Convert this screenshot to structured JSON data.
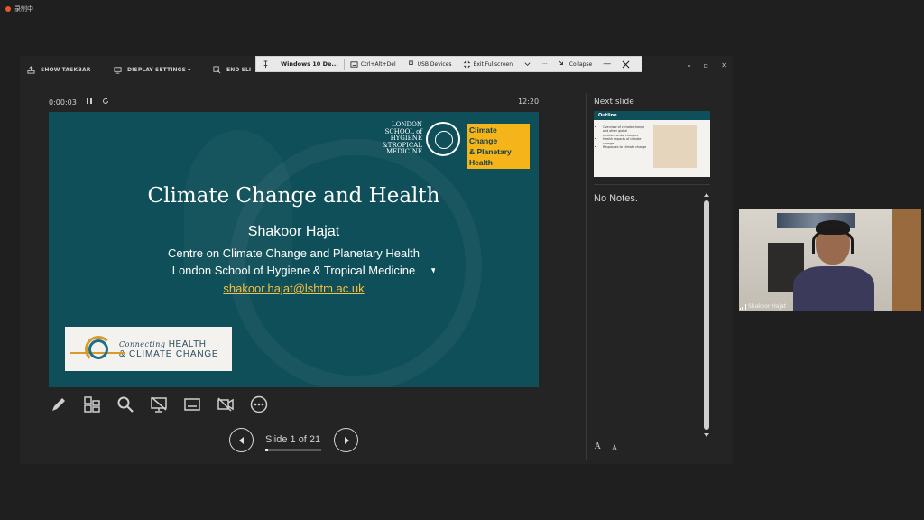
{
  "recorder": {
    "label": "录制中"
  },
  "toolbar": {
    "show_taskbar": "SHOW TASKBAR",
    "display_settings": "DISPLAY SETTINGS ▾",
    "end_slideshow": "END SLI"
  },
  "window_controls": {
    "minimize": "–",
    "restore": "▫",
    "close": "✕"
  },
  "remote_bar": {
    "title": "Windows 10 De...",
    "ctrl_alt_del": "Ctrl+Alt+Del",
    "usb": "USB Devices",
    "exit_fullscreen": "Exit Fullscreen",
    "more": "···",
    "collapse": "Collapse"
  },
  "timer": {
    "elapsed": "0:00:03",
    "clock": "12:20"
  },
  "slide": {
    "title": "Climate Change and Health",
    "name": "Shakoor Hajat",
    "affiliation_1": "Centre on Climate Change and Planetary Health",
    "affiliation_2": "London School of Hygiene & Tropical Medicine",
    "email": "shakoor.hajat@lshtm.ac.uk",
    "lshtm_lines": [
      "LONDON",
      "SCHOOL of",
      "HYGIENE",
      "&TROPICAL",
      "MEDICINE"
    ],
    "badge_lines": [
      "Climate Change",
      "& Planetary",
      "Health"
    ],
    "chcc_line1_italic": "Connecting",
    "chcc_line1": "HEALTH",
    "chcc_line2": "& CLIMATE CHANGE"
  },
  "navigation": {
    "counter": "Slide 1 of 21",
    "progress": 0.05
  },
  "side_panel": {
    "next_label": "Next slide",
    "thumb_title": "Outline",
    "thumb_items": [
      "Overview of climate change and other global environmental changes",
      "Health impacts of climate change",
      "Responses to climate change"
    ],
    "notes": "No Notes.",
    "font_up": "A",
    "font_down": "A"
  },
  "video": {
    "participant": "Shakoor Hajat"
  },
  "colors": {
    "slide_bg": "#0f4f59",
    "accent": "#f4b41a",
    "email": "#f4c243"
  }
}
